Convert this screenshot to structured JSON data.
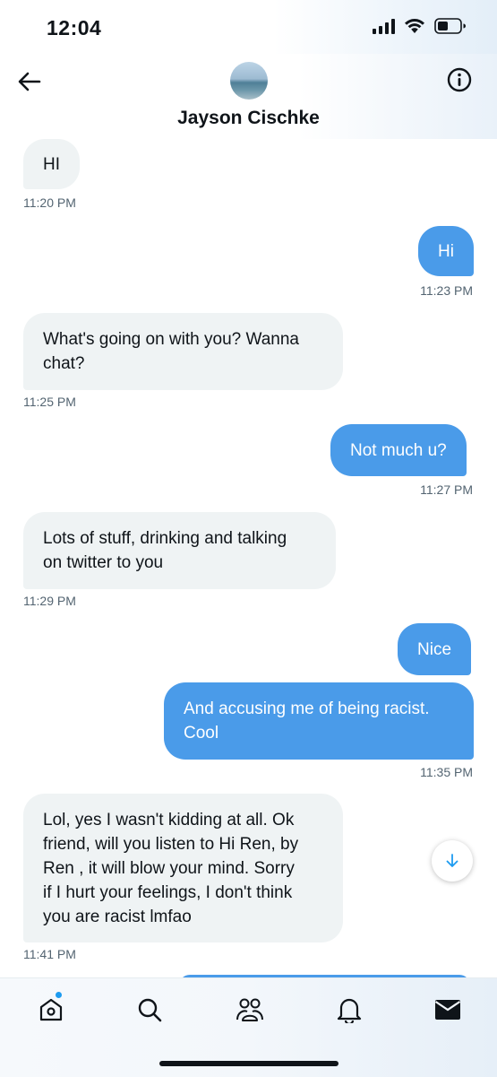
{
  "status_bar": {
    "time": "12:04"
  },
  "header": {
    "contact_name": "Jayson Cischke"
  },
  "messages": [
    {
      "direction": "in",
      "text": "HI",
      "time": "11:20 PM"
    },
    {
      "direction": "out",
      "text": "Hi",
      "time": "11:23 PM"
    },
    {
      "direction": "in",
      "text_lines": [
        "What's going on with you? Wanna",
        "chat?"
      ],
      "time": "11:25 PM"
    },
    {
      "direction": "out",
      "text": "Not much u?",
      "time": "11:27 PM"
    },
    {
      "direction": "in",
      "text_lines": [
        "Lots of stuff, drinking and talking",
        "on twitter to you"
      ],
      "time": "11:29 PM"
    },
    {
      "direction": "out",
      "text": "Nice"
    },
    {
      "direction": "out",
      "text_lines": [
        "And accusing me of being racist.",
        "Cool"
      ],
      "time": "11:35 PM"
    },
    {
      "direction": "in",
      "text_lines": [
        "Lol, yes I wasn't kidding at all. Ok",
        "friend, will you listen to Hi Ren, by",
        "Ren , it will blow your mind. Sorry",
        "if I hurt your feelings, I don't think",
        "you are racist lmfao"
      ],
      "time": "11:41 PM"
    }
  ],
  "tab_bar": {
    "items": [
      {
        "icon": "home-icon",
        "has_badge": true
      },
      {
        "icon": "search-icon"
      },
      {
        "icon": "communities-icon"
      },
      {
        "icon": "bell-icon"
      },
      {
        "icon": "mail-icon",
        "active": true
      }
    ]
  },
  "colors": {
    "outgoing_bubble": "#4a9be9",
    "incoming_bubble": "#eff3f4",
    "timestamp": "#536471",
    "accent": "#1d9bf0"
  }
}
